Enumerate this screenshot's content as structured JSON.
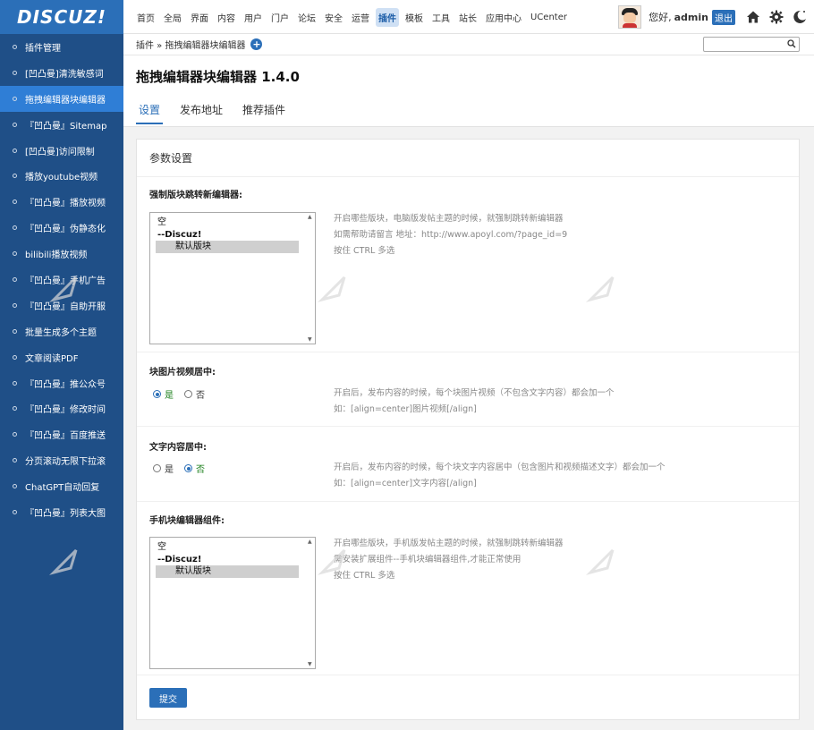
{
  "logo": "DISCUZ!",
  "nav": [
    "首页",
    "全局",
    "界面",
    "内容",
    "用户",
    "门户",
    "论坛",
    "安全",
    "运营",
    "插件",
    "模板",
    "工具",
    "站长",
    "应用中心",
    "UCenter"
  ],
  "nav_active_index": 9,
  "user": {
    "greeting": "您好,",
    "name": "admin",
    "logout": "退出"
  },
  "sidebar": [
    "插件管理",
    "[凹凸曼]清洗敏感词",
    "拖拽编辑器块编辑器",
    "『凹凸曼』Sitemap",
    "[凹凸曼]访问限制",
    "播放youtube视频",
    "『凹凸曼』播放视频",
    "『凹凸曼』伪静态化",
    "bilibili播放视频",
    "『凹凸曼』手机广告",
    "『凹凸曼』自助开服",
    "批量生成多个主题",
    "文章阅读PDF",
    "『凹凸曼』推公众号",
    "『凹凸曼』修改时间",
    "『凹凸曼』百度推送",
    "分页滚动无限下拉滚",
    "ChatGPT自动回复",
    "『凹凸曼』列表大图"
  ],
  "sidebar_active_index": 2,
  "breadcrumb": "插件 » 拖拽编辑器块编辑器",
  "page_title": "拖拽编辑器块编辑器 1.4.0",
  "tabs": [
    "设置",
    "发布地址",
    "推荐插件"
  ],
  "card_title": "参数设置",
  "fields": {
    "pc_blocks": {
      "label": "强制版块跳转新编辑器:",
      "options": [
        "空",
        "--Discuz!",
        "默认版块"
      ],
      "hint1": "开启哪些版块，电脑版发帖主题的时候，就强制跳转新编辑器",
      "hint2": "如需帮助请留言 地址：http://www.apoyl.com/?page_id=9",
      "hint3": "按住 CTRL 多选"
    },
    "image_center": {
      "label": "块图片视频居中:",
      "yes": "是",
      "no": "否",
      "hint1": "开启后，发布内容的时候，每个块图片视频（不包含文字内容）都会加一个",
      "hint2": "如：[align=center]图片视频[/align]"
    },
    "text_center": {
      "label": "文字内容居中:",
      "yes": "是",
      "no": "否",
      "hint1": "开启后，发布内容的时候，每个块文字内容居中（包含图片和视频描述文字）都会加一个",
      "hint2": "如：[align=center]文字内容[/align]"
    },
    "mobile_blocks": {
      "label": "手机块编辑器组件:",
      "options": [
        "空",
        "--Discuz!",
        "默认版块"
      ],
      "hint1": "开启哪些版块，手机版发帖主题的时候，就强制跳转新编辑器",
      "hint2": "需安装扩展组件--手机块编辑器组件,才能正常使用",
      "hint3": "按住 CTRL 多选"
    }
  },
  "submit": "提交",
  "colors": {
    "brand": "#2b6fb8",
    "sidebar": "#1f4f87",
    "sidebar_active": "#2f7ed6"
  }
}
